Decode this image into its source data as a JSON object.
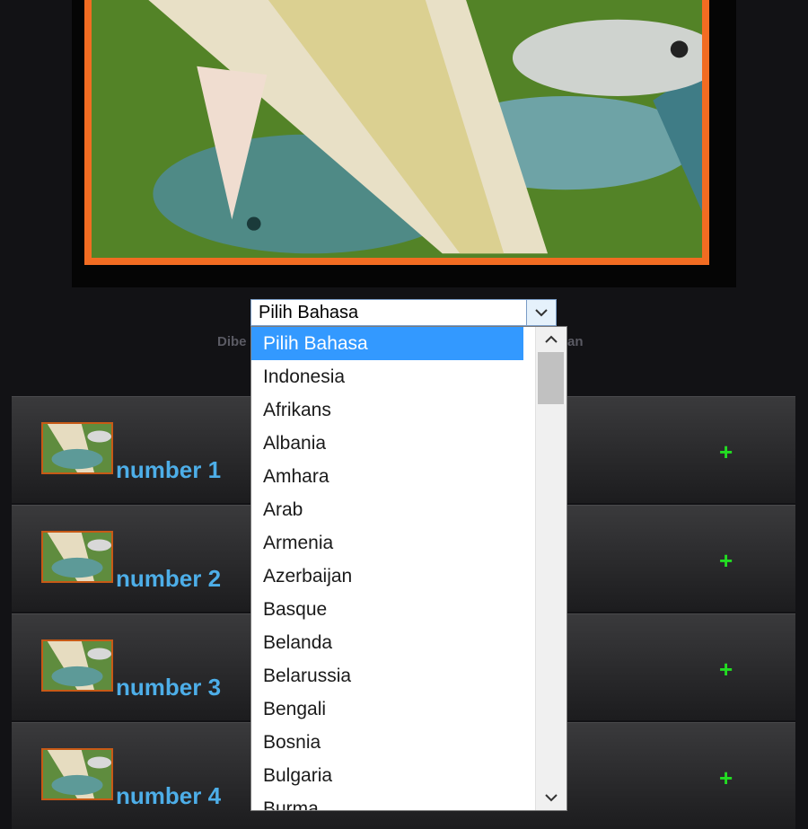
{
  "language_select": {
    "current_value": "Pilih Bahasa",
    "options": [
      "Pilih Bahasa",
      "Indonesia",
      "Afrikans",
      "Albania",
      "Amhara",
      "Arab",
      "Armenia",
      "Azerbaijan",
      "Basque",
      "Belanda",
      "Belarussia",
      "Bengali",
      "Bosnia",
      "Bulgaria",
      "Burma"
    ],
    "selected_index": 0
  },
  "powered_by": {
    "left_fragment": "Dibe",
    "right_fragment": "an"
  },
  "list": {
    "items": [
      {
        "label": "number 1",
        "expand": "+"
      },
      {
        "label": "number 2",
        "expand": "+"
      },
      {
        "label": "number 3",
        "expand": "+"
      },
      {
        "label": "number 4",
        "expand": "+"
      }
    ]
  },
  "colors": {
    "background": "#121215",
    "frame_accent": "#f26c22",
    "label_blue": "#4daee8",
    "plus_green": "#22dd22",
    "selection_blue": "#3399ff"
  },
  "icons": {
    "hero": "fish-photo",
    "thumbnail": "fish-thumbnail",
    "select_arrow": "chevron-down-icon",
    "scroll_up": "chevron-up-icon",
    "scroll_down": "chevron-down-icon"
  }
}
